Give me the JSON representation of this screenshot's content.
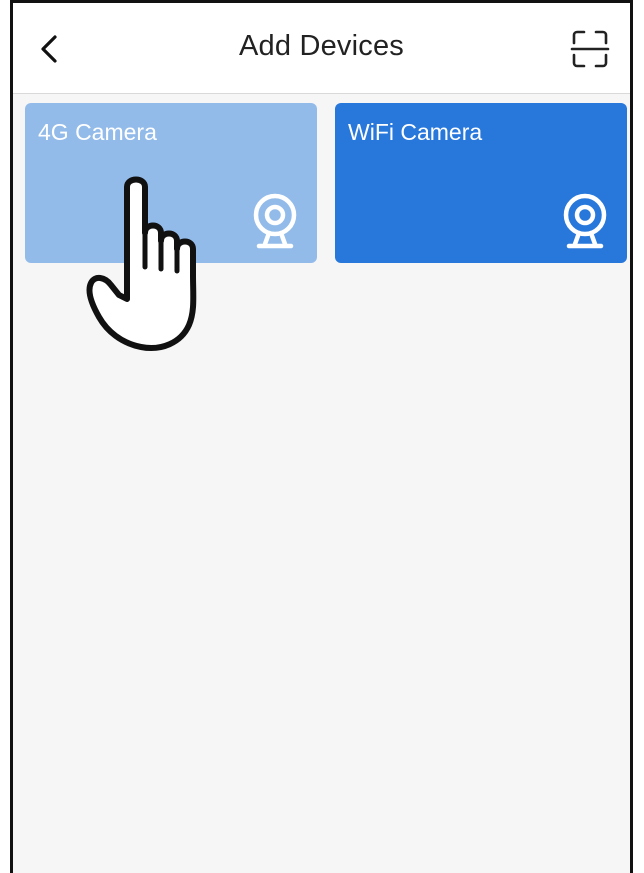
{
  "header": {
    "title": "Add Devices",
    "back_icon": "chevron-left-icon",
    "scan_icon": "scan-icon"
  },
  "devices": [
    {
      "label": "4G Camera",
      "icon": "webcam-icon",
      "color": "#93bbea"
    },
    {
      "label": "WiFi Camera",
      "icon": "webcam-icon",
      "color": "#2878dc"
    }
  ],
  "overlay": {
    "icon": "pointing-hand-icon"
  }
}
